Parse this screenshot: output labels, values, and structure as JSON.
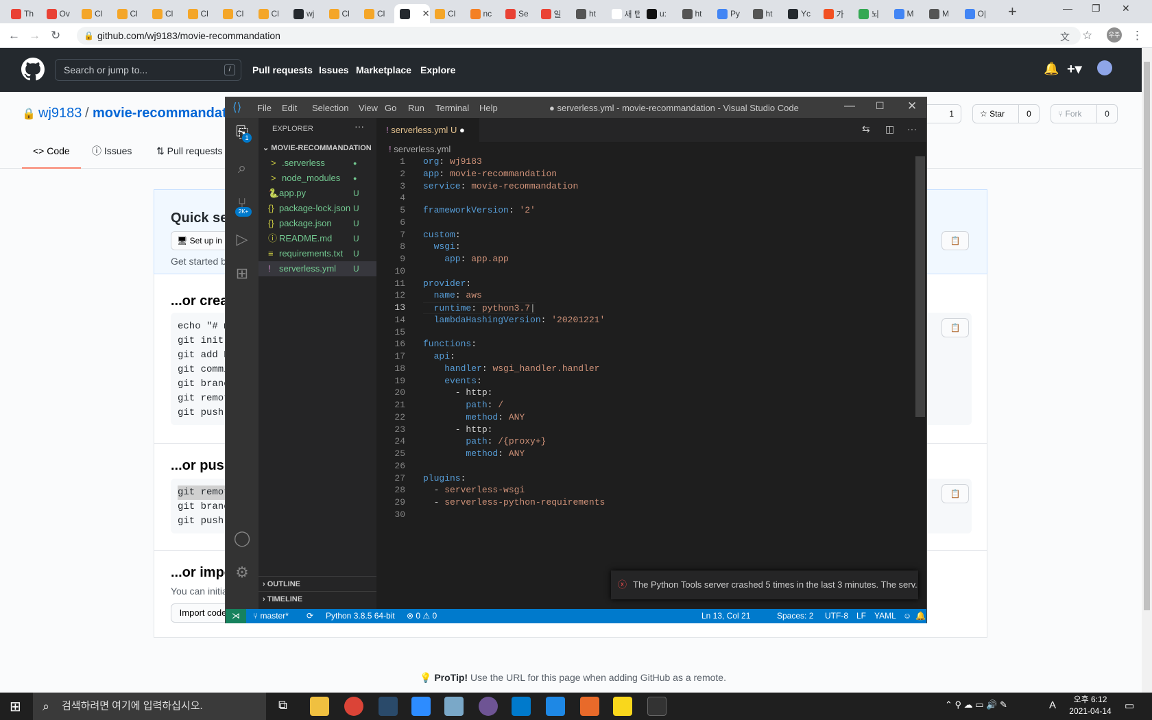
{
  "browser": {
    "tabs": [
      {
        "label": "Th",
        "color": "#e94235"
      },
      {
        "label": "Ov",
        "color": "#e94235"
      },
      {
        "label": "Cl",
        "color": "#f4a629"
      },
      {
        "label": "Cl",
        "color": "#f4a629"
      },
      {
        "label": "Cl",
        "color": "#f4a629"
      },
      {
        "label": "Cl",
        "color": "#f4a629"
      },
      {
        "label": "Cl",
        "color": "#f4a629"
      },
      {
        "label": "Cl",
        "color": "#f4a629"
      },
      {
        "label": "wj",
        "color": "#24292e"
      },
      {
        "label": "Cl",
        "color": "#f4a629"
      },
      {
        "label": "Cl",
        "color": "#f4a629"
      },
      {
        "label": "",
        "color": "#24292e"
      },
      {
        "label": "Cl",
        "color": "#f4a629"
      },
      {
        "label": "nc",
        "color": "#f48024"
      },
      {
        "label": "Se",
        "color": "#e94235"
      },
      {
        "label": "일",
        "color": "#ea4335"
      },
      {
        "label": "ht",
        "color": "#555"
      },
      {
        "label": "새 탭",
        "color": "#fff"
      },
      {
        "label": "u:",
        "color": "#111"
      },
      {
        "label": "ht",
        "color": "#555"
      },
      {
        "label": "Py",
        "color": "#4285f4"
      },
      {
        "label": "ht",
        "color": "#555"
      },
      {
        "label": "Yc",
        "color": "#24292e"
      },
      {
        "label": "가",
        "color": "#f25022"
      },
      {
        "label": "뇌",
        "color": "#34a853"
      },
      {
        "label": "M",
        "color": "#4285f4"
      },
      {
        "label": "M",
        "color": "#555"
      },
      {
        "label": "O|",
        "color": "#4285f4"
      }
    ],
    "url": "github.com/wj9183/movie-recommandation",
    "profile": "우주"
  },
  "github": {
    "search_placeholder": "Search or jump to...",
    "slash": "/",
    "nav": [
      "Pull requests",
      "Issues",
      "Marketplace",
      "Explore"
    ],
    "owner": "wj9183",
    "sep": "/",
    "repo": "movie-recommandati",
    "watch_count": "1",
    "star_label": "Star",
    "star_count": "0",
    "fork_label": "Fork",
    "fork_count": "0",
    "repo_tabs": [
      "Code",
      "Issues",
      "Pull requests"
    ],
    "quick_setup": "Quick se",
    "setup_btn": "Set up in",
    "get_started": "Get started b",
    "create_title": "...or crea",
    "create_code": [
      "echo \"# m",
      "git init",
      "git add R",
      "git commi",
      "git branc",
      "git remot",
      "git push"
    ],
    "push_title": "...or push",
    "push_code": [
      "git remot",
      "git branc",
      "git push"
    ],
    "import_title": "...or impo",
    "import_desc": "You can initia",
    "import_btn": "Import code",
    "protip_bold": "ProTip!",
    "protip": "Use the URL for this page when adding GitHub as a remote."
  },
  "vscode": {
    "title": "● serverless.yml - movie-recommandation - Visual Studio Code",
    "menu": [
      "File",
      "Edit",
      "Selection",
      "View",
      "Go",
      "Run",
      "Terminal",
      "Help"
    ],
    "explorer_label": "EXPLORER",
    "project": "MOVIE-RECOMMANDATION",
    "files": [
      {
        "name": ".serverless",
        "icon": ">",
        "badge": "●",
        "color": "#73c991"
      },
      {
        "name": "node_modules",
        "icon": ">",
        "badge": "●",
        "color": "#73c991"
      },
      {
        "name": "app.py",
        "icon": "🐍",
        "badge": "U",
        "color": "#73c991"
      },
      {
        "name": "package-lock.json",
        "icon": "{}",
        "badge": "U",
        "color": "#73c991"
      },
      {
        "name": "package.json",
        "icon": "{}",
        "badge": "U",
        "color": "#73c991"
      },
      {
        "name": "README.md",
        "icon": "ⓘ",
        "badge": "U",
        "color": "#73c991"
      },
      {
        "name": "requirements.txt",
        "icon": "≡",
        "badge": "U",
        "color": "#73c991"
      },
      {
        "name": "serverless.yml",
        "icon": "!",
        "badge": "U",
        "color": "#73c991"
      }
    ],
    "outline": "OUTLINE",
    "timeline": "TIMELINE",
    "tab_label": "serverless.yml",
    "tab_status": "U",
    "breadcrumb": "serverless.yml",
    "scm_badge": "2K+",
    "explorer_badge": "1",
    "code": [
      [
        "org",
        ": ",
        "wj9183"
      ],
      [
        "app",
        ": ",
        "movie-recommandation"
      ],
      [
        "service",
        ": ",
        "movie-recommandation"
      ],
      [
        "",
        "",
        ""
      ],
      [
        "frameworkVersion",
        ": ",
        "'2'"
      ],
      [
        "",
        "",
        ""
      ],
      [
        "custom",
        ":",
        ""
      ],
      [
        "  wsgi",
        ":",
        ""
      ],
      [
        "    app",
        ": ",
        "app.app"
      ],
      [
        "",
        "",
        ""
      ],
      [
        "provider",
        ":",
        ""
      ],
      [
        "  name",
        ": ",
        "aws"
      ],
      [
        "  runtime",
        ": ",
        "python3.7"
      ],
      [
        "  lambdaHashingVersion",
        ": ",
        "'20201221'"
      ],
      [
        "",
        "",
        ""
      ],
      [
        "functions",
        ":",
        ""
      ],
      [
        "  api",
        ":",
        ""
      ],
      [
        "    handler",
        ": ",
        "wsgi_handler.handler"
      ],
      [
        "    events",
        ":",
        ""
      ],
      [
        "      - http",
        ":",
        ""
      ],
      [
        "        path",
        ": ",
        "/"
      ],
      [
        "        method",
        ": ",
        "ANY"
      ],
      [
        "      - http",
        ":",
        ""
      ],
      [
        "        path",
        ": ",
        "/{proxy+}"
      ],
      [
        "        method",
        ": ",
        "ANY"
      ],
      [
        "",
        "",
        ""
      ],
      [
        "plugins",
        ":",
        ""
      ],
      [
        "  - ",
        "",
        "serverless-wsgi"
      ],
      [
        "  - ",
        "",
        "serverless-python-requirements"
      ],
      [
        "",
        "",
        ""
      ]
    ],
    "notification": "The Python Tools server crashed 5 times in the last 3 minutes. The serv...",
    "status": {
      "branch": "master*",
      "python": "Python 3.8.5 64-bit",
      "problems": "⊗ 0 ⚠ 0",
      "pos": "Ln 13, Col 21",
      "spaces": "Spaces: 2",
      "enc": "UTF-8",
      "eol": "LF",
      "lang": "YAML"
    }
  },
  "taskbar": {
    "search": "검색하려면 여기에 입력하십시오.",
    "time": "오후 6:12",
    "date": "2021-04-14",
    "ime": "A"
  }
}
